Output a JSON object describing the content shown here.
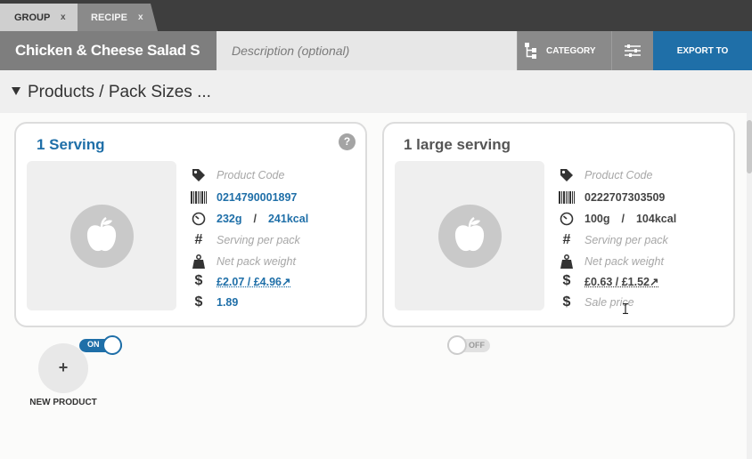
{
  "tabs": [
    {
      "label": "GROUP",
      "close": "x"
    },
    {
      "label": "RECIPE",
      "close": "x"
    }
  ],
  "header": {
    "title": "Chicken & Cheese Salad S",
    "description_placeholder": "Description (optional)",
    "category_label": "CATEGORY",
    "export_label": "EXPORT TO"
  },
  "section": {
    "title": "Products / Pack Sizes ..."
  },
  "products": [
    {
      "title": "1 Serving",
      "help": "?",
      "product_code": "Product Code",
      "barcode": "0214790001897",
      "weight": "232g",
      "separator": "/",
      "energy": "241kcal",
      "serving_per_pack": "Serving per pack",
      "net_pack_weight": "Net pack weight",
      "cost": "£2.07 / £4.96↗",
      "sale_price": "1.89",
      "toggle": "ON"
    },
    {
      "title": "1 large serving",
      "product_code": "Product Code",
      "barcode": "0222707303509",
      "weight": "100g",
      "separator": "/",
      "energy": "104kcal",
      "serving_per_pack": "Serving per pack",
      "net_pack_weight": "Net pack weight",
      "cost": "£0.63 / £1.52↗",
      "sale_price": "Sale price",
      "toggle": "OFF"
    }
  ],
  "new_product": {
    "icon": "+",
    "label": "NEW PRODUCT"
  },
  "colors": {
    "accent": "#1f6fa8",
    "header": "#808080",
    "tabbar": "#3e3e3e"
  },
  "icons": [
    "tag-icon",
    "barcode-icon",
    "timer-icon",
    "hash-icon",
    "weight-icon",
    "dollar-icon",
    "apple-icon",
    "hierarchy-icon",
    "sliders-icon"
  ]
}
